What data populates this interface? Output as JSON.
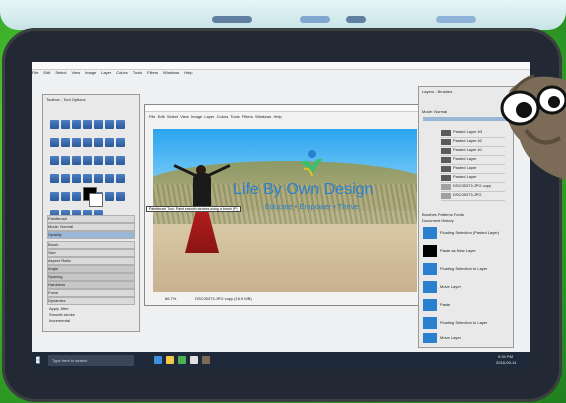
{
  "colors": {
    "background": "#3fb52a",
    "tablet_frame": "#222934",
    "screen_bg": "#eef0f2",
    "accent_logo": "#2a7fcf",
    "skirt": "#b81d1d",
    "taskbar": "#1e2a3a"
  },
  "image_window": {
    "menu": [
      "File",
      "Edit",
      "Select",
      "View",
      "Image",
      "Layer",
      "Colors",
      "Tools",
      "Filters",
      "Windows",
      "Help"
    ],
    "tooltip": "Paintbrush Tool: Paint smooth strokes using a brush (P)",
    "canvas_text": {
      "title": "Life By Own Design",
      "tagline": "Educate • Empower • Thrive"
    }
  },
  "main_menu": [
    "File",
    "Edit",
    "Select",
    "View",
    "Image",
    "Layer",
    "Colors",
    "Tools",
    "Filters",
    "Windows",
    "Help"
  ],
  "toolbox": {
    "title": "Toolbox - Tool Options",
    "options": [
      "Paintbrush",
      "Mode: Normal",
      "Opacity",
      "Brush",
      "Size",
      "Aspect Ratio",
      "Angle",
      "Spacing",
      "Hardness",
      "Force",
      "Dynamics",
      "Apply Jitter",
      "Smooth stroke",
      "Incremental"
    ]
  },
  "layers_panel": {
    "title": "Layers - Brushes",
    "mode_label": "Mode: Normal",
    "layers": [
      "Pasted Layer #3",
      "Pasted Layer #2",
      "Pasted Layer #1",
      "Pasted Layer",
      "Pasted Layer",
      "Pasted Layer",
      "DSC05373.JPG copy",
      "DSC05373.JPG"
    ]
  },
  "brushes_panel": {
    "tabs": [
      "Brushes",
      "Patterns",
      "Fonts",
      "Document History"
    ],
    "items": [
      "Floating Selection (Pasted Layer)",
      "Paste as New Layer",
      "Floating Selection to Layer",
      "Move Layer",
      "Paste",
      "Floating Selection to Layer",
      "Move Layer"
    ]
  },
  "statusbar": {
    "zoom": "66.7%",
    "info": "DSC05373.JPG copy (16.9 MB)"
  },
  "taskbar": {
    "search_placeholder": "Type here to search",
    "time": "9:34 PM",
    "date": "2018-09-14"
  },
  "icons": [
    "search-icon",
    "windows-icon",
    "gimp-logo-icon",
    "paintbrush-icon",
    "eye-icon"
  ]
}
